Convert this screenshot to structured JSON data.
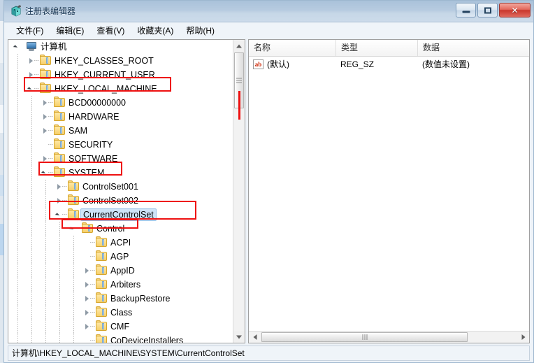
{
  "window": {
    "title": "注册表编辑器",
    "icon": "registry-editor-icon",
    "controls": {
      "minimize": "最小化",
      "maximize": "最大化",
      "close": "✕"
    }
  },
  "menubar": {
    "items": [
      {
        "label": "文件(F)"
      },
      {
        "label": "编辑(E)"
      },
      {
        "label": "查看(V)"
      },
      {
        "label": "收藏夹(A)"
      },
      {
        "label": "帮助(H)"
      }
    ]
  },
  "tree": {
    "nodes": [
      {
        "label": "计算机",
        "depth": 0,
        "expander": "open",
        "icon": "computer-icon",
        "selected": false
      },
      {
        "label": "HKEY_CLASSES_ROOT",
        "depth": 1,
        "expander": "closed",
        "icon": "folder-icon",
        "selected": false
      },
      {
        "label": "HKEY_CURRENT_USER",
        "depth": 1,
        "expander": "closed",
        "icon": "folder-icon",
        "selected": false
      },
      {
        "label": "HKEY_LOCAL_MACHINE",
        "depth": 1,
        "expander": "open",
        "icon": "folder-icon",
        "selected": false
      },
      {
        "label": "BCD00000000",
        "depth": 2,
        "expander": "closed",
        "icon": "folder-icon",
        "selected": false
      },
      {
        "label": "HARDWARE",
        "depth": 2,
        "expander": "closed",
        "icon": "folder-icon",
        "selected": false
      },
      {
        "label": "SAM",
        "depth": 2,
        "expander": "closed",
        "icon": "folder-icon",
        "selected": false
      },
      {
        "label": "SECURITY",
        "depth": 2,
        "expander": "none",
        "icon": "folder-icon",
        "selected": false
      },
      {
        "label": "SOFTWARE",
        "depth": 2,
        "expander": "closed",
        "icon": "folder-icon",
        "selected": false
      },
      {
        "label": "SYSTEM",
        "depth": 2,
        "expander": "open",
        "icon": "folder-icon",
        "selected": false
      },
      {
        "label": "ControlSet001",
        "depth": 3,
        "expander": "closed",
        "icon": "folder-icon",
        "selected": false
      },
      {
        "label": "ControlSet002",
        "depth": 3,
        "expander": "closed",
        "icon": "folder-icon",
        "selected": false
      },
      {
        "label": "CurrentControlSet",
        "depth": 3,
        "expander": "open",
        "icon": "folder-icon",
        "selected": true
      },
      {
        "label": "Control",
        "depth": 4,
        "expander": "open",
        "icon": "folder-icon",
        "selected": false
      },
      {
        "label": "ACPI",
        "depth": 5,
        "expander": "none",
        "icon": "folder-icon",
        "selected": false
      },
      {
        "label": "AGP",
        "depth": 5,
        "expander": "none",
        "icon": "folder-icon",
        "selected": false
      },
      {
        "label": "AppID",
        "depth": 5,
        "expander": "closed",
        "icon": "folder-icon",
        "selected": false
      },
      {
        "label": "Arbiters",
        "depth": 5,
        "expander": "closed",
        "icon": "folder-icon",
        "selected": false
      },
      {
        "label": "BackupRestore",
        "depth": 5,
        "expander": "closed",
        "icon": "folder-icon",
        "selected": false
      },
      {
        "label": "Class",
        "depth": 5,
        "expander": "closed",
        "icon": "folder-icon",
        "selected": false
      },
      {
        "label": "CMF",
        "depth": 5,
        "expander": "closed",
        "icon": "folder-icon",
        "selected": false
      },
      {
        "label": "CoDeviceInstallers",
        "depth": 5,
        "expander": "none",
        "icon": "folder-icon",
        "selected": false
      }
    ]
  },
  "list": {
    "columns": [
      {
        "label": "名称"
      },
      {
        "label": "类型"
      },
      {
        "label": "数据"
      }
    ],
    "rows": [
      {
        "name": "(默认)",
        "type": "REG_SZ",
        "data": "(数值未设置)",
        "icon": "string-value-icon",
        "icon_text": "ab"
      }
    ]
  },
  "statusbar": {
    "path": "计算机\\HKEY_LOCAL_MACHINE\\SYSTEM\\CurrentControlSet"
  },
  "annotations": {
    "color": "#ee1111",
    "boxes": [
      {
        "target": "HKEY_LOCAL_MACHINE"
      },
      {
        "target": "SYSTEM"
      },
      {
        "target": "CurrentControlSet"
      },
      {
        "target": "Control"
      }
    ],
    "lines": [
      {
        "target": "vertical-scrollbar-marker"
      }
    ]
  }
}
